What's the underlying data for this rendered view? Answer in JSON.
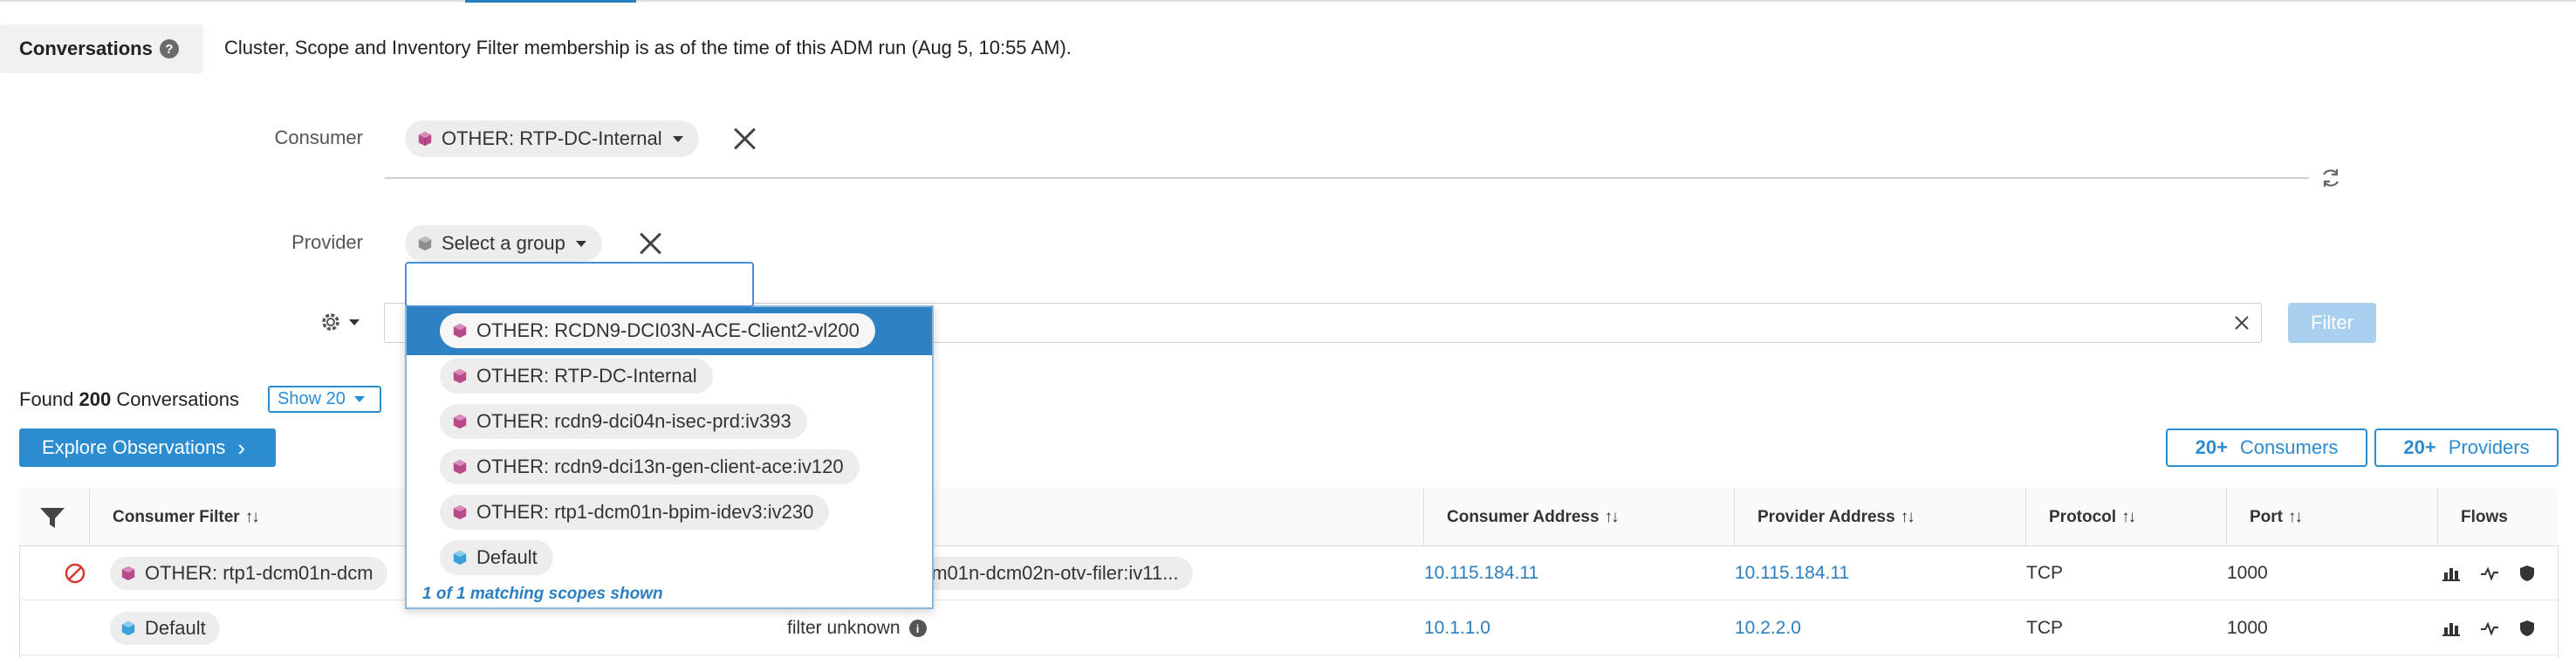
{
  "header": {
    "tab_label": "Conversations",
    "help_glyph": "?",
    "info_text": "Cluster, Scope and Inventory Filter membership is as of the time of this ADM run (Aug 5, 10:55 AM)."
  },
  "consumer": {
    "label": "Consumer",
    "selected": "OTHER: RTP-DC-Internal"
  },
  "provider": {
    "label": "Provider",
    "selected": "Select a group",
    "search_value": ""
  },
  "filter": {
    "button_label": "Filter"
  },
  "summary": {
    "found_prefix": "Found",
    "found_count": "200",
    "found_suffix": "Conversations",
    "show_label": "Show 20"
  },
  "actions": {
    "explore_label": "Explore Observations",
    "consumers_count": "20+",
    "consumers_label": "Consumers",
    "providers_count": "20+",
    "providers_label": "Providers"
  },
  "table": {
    "columns": [
      "Consumer Filter",
      "Consumer Address",
      "Provider Address",
      "Protocol",
      "Port",
      "Flows"
    ],
    "rows": [
      {
        "consumer_filter": "OTHER: rtp1-dcm01n-dcm",
        "provider_filter": "dcm01n-dcm02n-otv-filer:iv11...",
        "consumer_address": "10.115.184.11",
        "provider_address": "10.115.184.11",
        "protocol": "TCP",
        "port": "1000"
      },
      {
        "consumer_filter": "Default",
        "provider_filter": "filter unknown",
        "consumer_address": "10.1.1.0",
        "provider_address": "10.2.2.0",
        "protocol": "TCP",
        "port": "1000"
      }
    ]
  },
  "dropdown": {
    "items": [
      "OTHER: RCDN9-DCI03N-ACE-Client2-vl200",
      "OTHER: RTP-DC-Internal",
      "OTHER: rcdn9-dci04n-isec-prd:iv393",
      "OTHER: rcdn9-dci13n-gen-client-ace:iv120",
      "OTHER: rtp1-dcm01n-bpim-idev3:iv230",
      "Default"
    ],
    "footer": "1 of 1 matching scopes shown"
  },
  "colors": {
    "accent": "#2b8cd0",
    "other_scope": "#b94a8a",
    "default_scope": "#3aa0d8"
  },
  "icons": {
    "scope": "cube-icon",
    "clear": "close-icon",
    "refresh": "refresh-icon",
    "settings": "gear-icon",
    "filter_col": "funnel-icon",
    "denied": "prohibited-icon"
  }
}
